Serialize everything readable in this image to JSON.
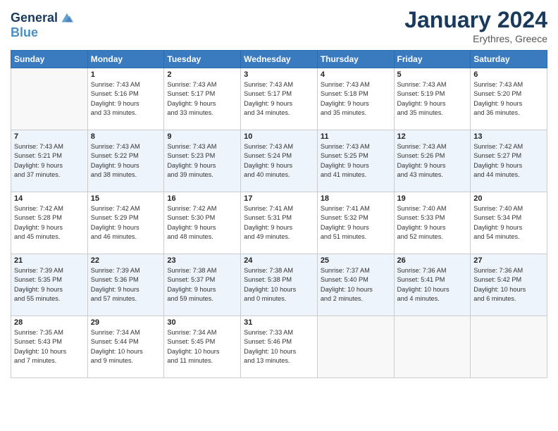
{
  "header": {
    "logo_line1": "General",
    "logo_line2": "Blue",
    "month_year": "January 2024",
    "location": "Erythres, Greece"
  },
  "weekdays": [
    "Sunday",
    "Monday",
    "Tuesday",
    "Wednesday",
    "Thursday",
    "Friday",
    "Saturday"
  ],
  "weeks": [
    [
      {
        "day": "",
        "info": ""
      },
      {
        "day": "1",
        "info": "Sunrise: 7:43 AM\nSunset: 5:16 PM\nDaylight: 9 hours\nand 33 minutes."
      },
      {
        "day": "2",
        "info": "Sunrise: 7:43 AM\nSunset: 5:17 PM\nDaylight: 9 hours\nand 33 minutes."
      },
      {
        "day": "3",
        "info": "Sunrise: 7:43 AM\nSunset: 5:17 PM\nDaylight: 9 hours\nand 34 minutes."
      },
      {
        "day": "4",
        "info": "Sunrise: 7:43 AM\nSunset: 5:18 PM\nDaylight: 9 hours\nand 35 minutes."
      },
      {
        "day": "5",
        "info": "Sunrise: 7:43 AM\nSunset: 5:19 PM\nDaylight: 9 hours\nand 35 minutes."
      },
      {
        "day": "6",
        "info": "Sunrise: 7:43 AM\nSunset: 5:20 PM\nDaylight: 9 hours\nand 36 minutes."
      }
    ],
    [
      {
        "day": "7",
        "info": "Sunrise: 7:43 AM\nSunset: 5:21 PM\nDaylight: 9 hours\nand 37 minutes."
      },
      {
        "day": "8",
        "info": "Sunrise: 7:43 AM\nSunset: 5:22 PM\nDaylight: 9 hours\nand 38 minutes."
      },
      {
        "day": "9",
        "info": "Sunrise: 7:43 AM\nSunset: 5:23 PM\nDaylight: 9 hours\nand 39 minutes."
      },
      {
        "day": "10",
        "info": "Sunrise: 7:43 AM\nSunset: 5:24 PM\nDaylight: 9 hours\nand 40 minutes."
      },
      {
        "day": "11",
        "info": "Sunrise: 7:43 AM\nSunset: 5:25 PM\nDaylight: 9 hours\nand 41 minutes."
      },
      {
        "day": "12",
        "info": "Sunrise: 7:43 AM\nSunset: 5:26 PM\nDaylight: 9 hours\nand 43 minutes."
      },
      {
        "day": "13",
        "info": "Sunrise: 7:42 AM\nSunset: 5:27 PM\nDaylight: 9 hours\nand 44 minutes."
      }
    ],
    [
      {
        "day": "14",
        "info": "Sunrise: 7:42 AM\nSunset: 5:28 PM\nDaylight: 9 hours\nand 45 minutes."
      },
      {
        "day": "15",
        "info": "Sunrise: 7:42 AM\nSunset: 5:29 PM\nDaylight: 9 hours\nand 46 minutes."
      },
      {
        "day": "16",
        "info": "Sunrise: 7:42 AM\nSunset: 5:30 PM\nDaylight: 9 hours\nand 48 minutes."
      },
      {
        "day": "17",
        "info": "Sunrise: 7:41 AM\nSunset: 5:31 PM\nDaylight: 9 hours\nand 49 minutes."
      },
      {
        "day": "18",
        "info": "Sunrise: 7:41 AM\nSunset: 5:32 PM\nDaylight: 9 hours\nand 51 minutes."
      },
      {
        "day": "19",
        "info": "Sunrise: 7:40 AM\nSunset: 5:33 PM\nDaylight: 9 hours\nand 52 minutes."
      },
      {
        "day": "20",
        "info": "Sunrise: 7:40 AM\nSunset: 5:34 PM\nDaylight: 9 hours\nand 54 minutes."
      }
    ],
    [
      {
        "day": "21",
        "info": "Sunrise: 7:39 AM\nSunset: 5:35 PM\nDaylight: 9 hours\nand 55 minutes."
      },
      {
        "day": "22",
        "info": "Sunrise: 7:39 AM\nSunset: 5:36 PM\nDaylight: 9 hours\nand 57 minutes."
      },
      {
        "day": "23",
        "info": "Sunrise: 7:38 AM\nSunset: 5:37 PM\nDaylight: 9 hours\nand 59 minutes."
      },
      {
        "day": "24",
        "info": "Sunrise: 7:38 AM\nSunset: 5:38 PM\nDaylight: 10 hours\nand 0 minutes."
      },
      {
        "day": "25",
        "info": "Sunrise: 7:37 AM\nSunset: 5:40 PM\nDaylight: 10 hours\nand 2 minutes."
      },
      {
        "day": "26",
        "info": "Sunrise: 7:36 AM\nSunset: 5:41 PM\nDaylight: 10 hours\nand 4 minutes."
      },
      {
        "day": "27",
        "info": "Sunrise: 7:36 AM\nSunset: 5:42 PM\nDaylight: 10 hours\nand 6 minutes."
      }
    ],
    [
      {
        "day": "28",
        "info": "Sunrise: 7:35 AM\nSunset: 5:43 PM\nDaylight: 10 hours\nand 7 minutes."
      },
      {
        "day": "29",
        "info": "Sunrise: 7:34 AM\nSunset: 5:44 PM\nDaylight: 10 hours\nand 9 minutes."
      },
      {
        "day": "30",
        "info": "Sunrise: 7:34 AM\nSunset: 5:45 PM\nDaylight: 10 hours\nand 11 minutes."
      },
      {
        "day": "31",
        "info": "Sunrise: 7:33 AM\nSunset: 5:46 PM\nDaylight: 10 hours\nand 13 minutes."
      },
      {
        "day": "",
        "info": ""
      },
      {
        "day": "",
        "info": ""
      },
      {
        "day": "",
        "info": ""
      }
    ]
  ]
}
